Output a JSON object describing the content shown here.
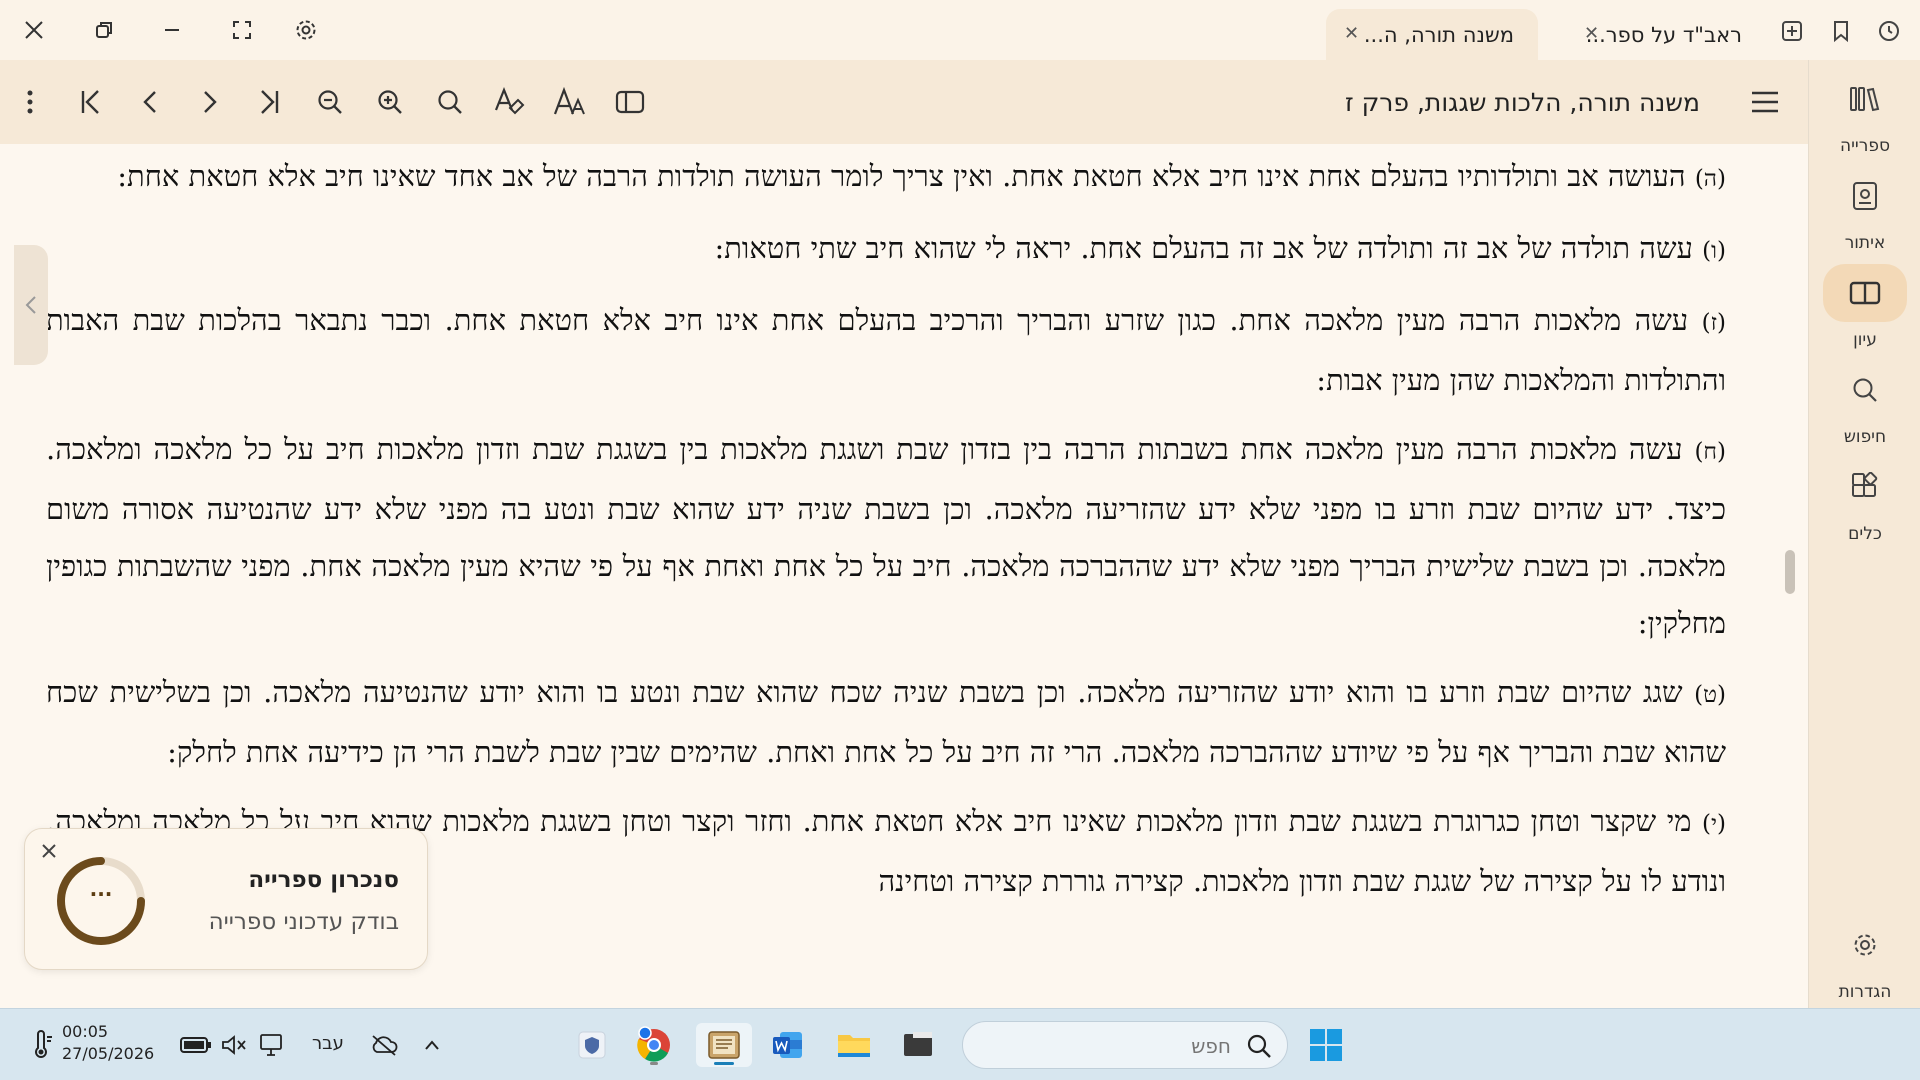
{
  "window": {
    "tabs": [
      {
        "label": "משנה תורה, ה...",
        "active": true
      },
      {
        "label": "ראב\"ד על ספר...",
        "active": false
      }
    ]
  },
  "toolbar": {
    "doc_title": "משנה תורה, הלכות שגגות, פרק ז"
  },
  "rail": {
    "items": [
      {
        "label": "ספרייה",
        "icon": "library-icon"
      },
      {
        "label": "איתור",
        "icon": "locate-icon"
      },
      {
        "label": "עיון",
        "icon": "book-open-icon",
        "active": true
      },
      {
        "label": "חיפוש",
        "icon": "search-icon"
      },
      {
        "label": "כלים",
        "icon": "tools-icon"
      },
      {
        "label": "הגדרות",
        "icon": "settings-icon"
      }
    ]
  },
  "content": {
    "paragraphs": [
      {
        "num": "(ה)",
        "text": "העושה אב ותולדותיו בהעלם אחת אינו חיב אלא חטאת אחת. ואין צריך לומר העושה תולדות הרבה של אב אחד שאינו חיב אלא חטאת אחת:"
      },
      {
        "num": "(ו)",
        "text": "עשה תולדה של אב זה ותולדה של אב זה בהעלם אחת. יראה לי שהוא חיב שתי חטאות:"
      },
      {
        "num": "(ז)",
        "text": "עשה מלאכות הרבה מעין מלאכה אחת. כגון שזרע והבריך והרכיב בהעלם אחת אינו חיב אלא חטאת אחת. וכבר נתבאר בהלכות שבת האבות והתולדות והמלאכות שהן מעין אבות:"
      },
      {
        "num": "(ח)",
        "text": "עשה מלאכות הרבה מעין מלאכה אחת בשבתות הרבה בין בזדון שבת ושגגת מלאכות בין בשגגת שבת וזדון מלאכות חיב על כל מלאכה ומלאכה. כיצד. ידע שהיום שבת וזרע בו מפני שלא ידע שהזריעה מלאכה. וכן בשבת שניה ידע שהוא שבת ונטע בה מפני שלא ידע שהנטיעה אסורה משום מלאכה. וכן בשבת שלישית הבריך מפני שלא ידע שההברכה מלאכה. חיב על כל אחת ואחת אף על פי שהיא מעין מלאכה אחת. מפני שהשבתות כגופין מחלקין:"
      },
      {
        "num": "(ט)",
        "text": "שגג שהיום שבת וזרע בו והוא יודע שהזריעה מלאכה. וכן בשבת שניה שכח שהוא שבת ונטע בו והוא יודע שהנטיעה מלאכה. וכן בשלישית שכח שהוא שבת והבריך אף על פי שיודע שההברכה מלאכה. הרי זה חיב על כל אחת ואחת. שהימים שבין שבת לשבת הרי הן כידיעה אחת לחלק:"
      },
      {
        "num": "(י)",
        "text": "מי שקצר וטחן כגרוגרת בשגגת שבת וזדון מלאכות שאינו חיב אלא חטאת אחת. וחזר וקצר וטחן בשגגת מלאכות שהוא חיב על כל מלאכה ומלאכה. ונודע לו על קצירה של שגגת שבת וזדון מלאכות. קצירה גוררת קצירה וטחינה"
      }
    ]
  },
  "toast": {
    "title": "סנכרון ספרייה",
    "subtitle": "בודק עדכוני ספרייה",
    "spinner_text": "..."
  },
  "taskbar": {
    "time": "00:05",
    "date": "27/05/2026",
    "language": "עבר",
    "search_placeholder": "חפש"
  },
  "colors": {
    "accent": "#f3d9b7",
    "toolbar_bg": "#f6e9d7",
    "page_bg": "#fdf7ef",
    "spinner": "#6b4a1c"
  }
}
